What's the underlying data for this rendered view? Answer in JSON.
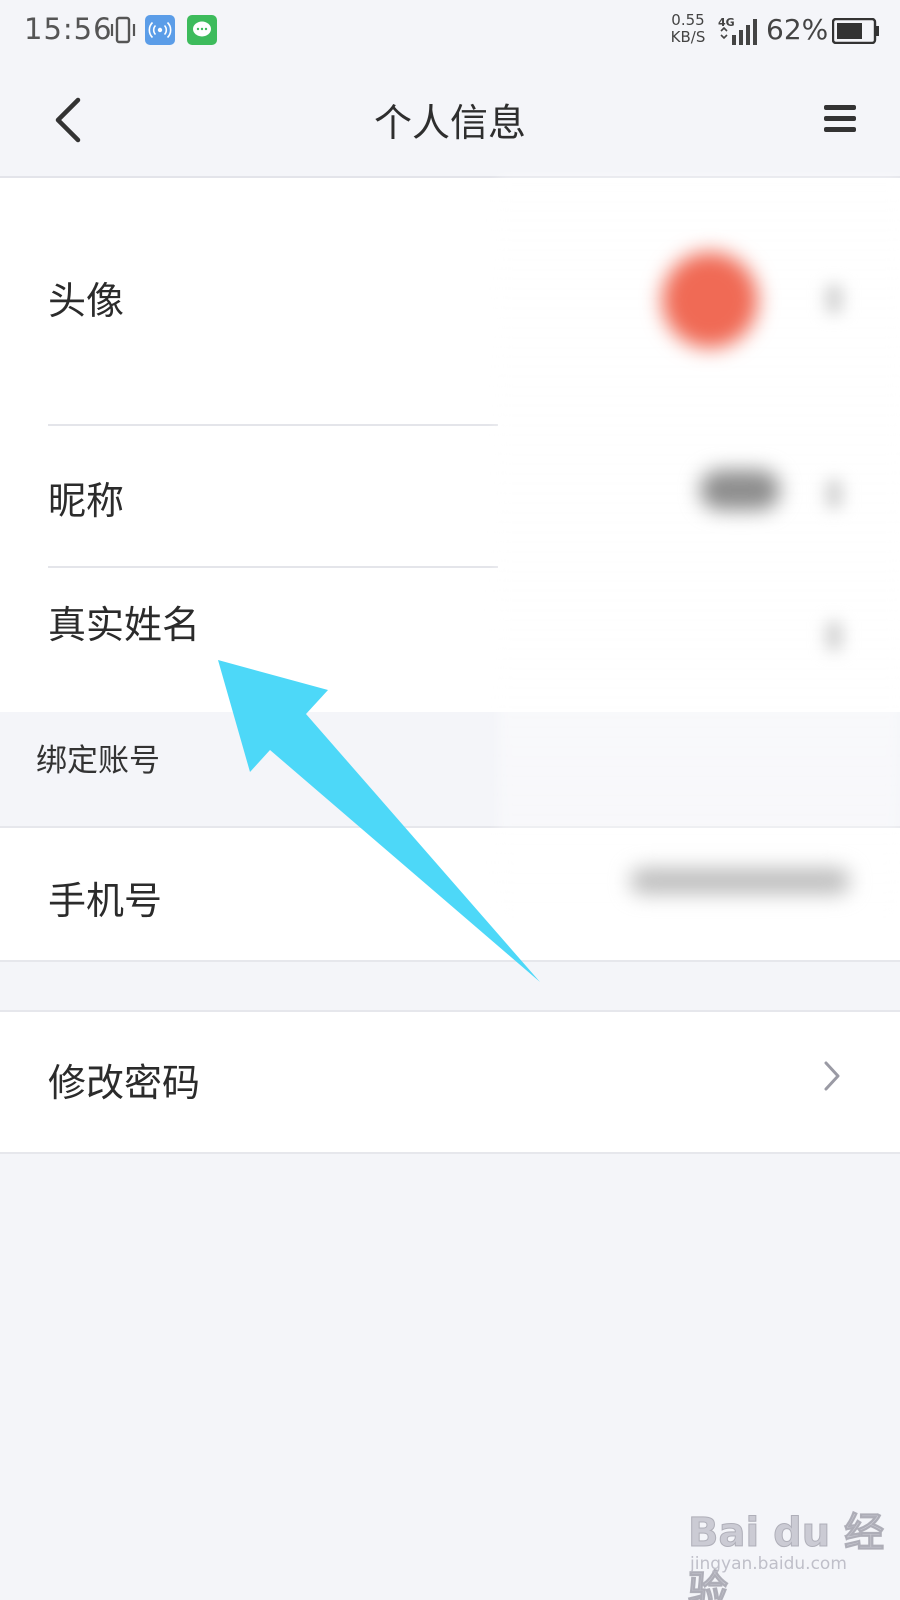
{
  "status_bar": {
    "time": "15:56",
    "net_speed_value": "0.55",
    "net_speed_unit": "KB/S",
    "network_type": "4G",
    "battery_percent": "62%",
    "icons": [
      "vibrate-icon",
      "hotspot-icon",
      "message-icon",
      "signal-icon",
      "battery-icon"
    ],
    "hotspot_color": "#5b9de8",
    "message_color": "#3dbb5c"
  },
  "nav": {
    "title": "个人信息",
    "back_icon": "chevron-left-icon",
    "menu_icon": "hamburger-menu-icon"
  },
  "profile_rows": [
    {
      "label": "头像"
    },
    {
      "label": "昵称"
    },
    {
      "label": "真实姓名"
    }
  ],
  "bind_section": {
    "header": "绑定账号",
    "rows": [
      {
        "label": "手机号"
      }
    ]
  },
  "password_row": {
    "label": "修改密码",
    "icon": "chevron-right-icon"
  },
  "annotation": {
    "color": "#4dd8f8",
    "icon": "arrow-annotation"
  },
  "watermark": {
    "logo": "Bai du 经验",
    "url": "jingyan.baidu.com"
  },
  "colors": {
    "background": "#f4f5f9",
    "card": "#ffffff",
    "avatar": "#f06a55"
  }
}
